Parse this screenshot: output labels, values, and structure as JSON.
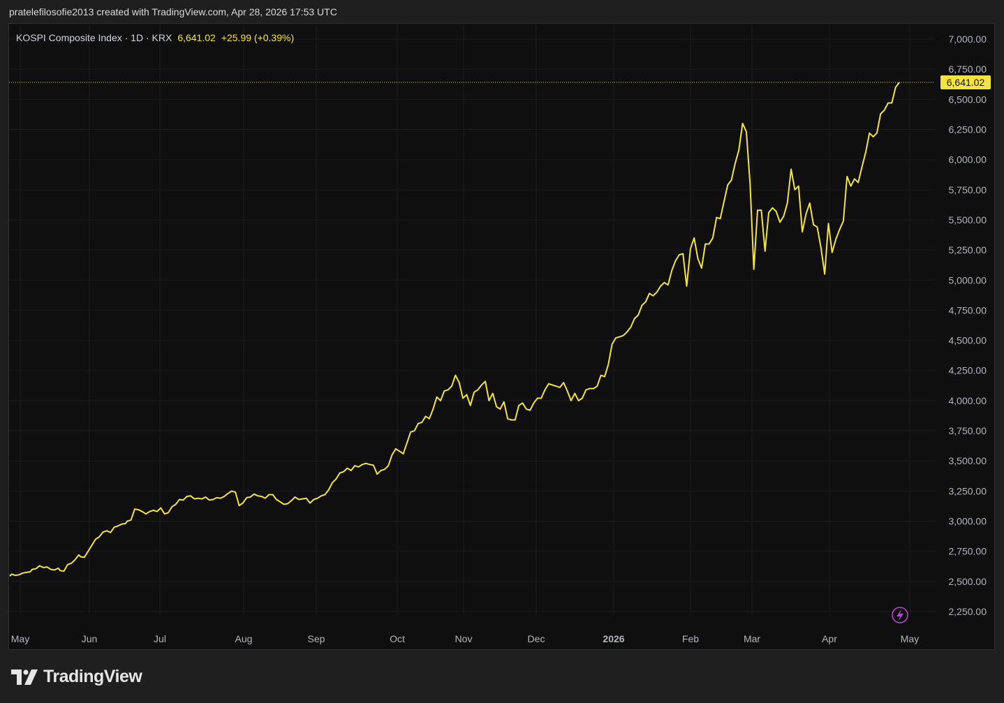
{
  "attribution": "pratelefilosofie2013 created with TradingView.com, Apr 28, 2026 17:53 UTC",
  "legend": {
    "symbol": "KOSPI Composite Index · 1D · KRX",
    "last": "6,641.02",
    "change": "+25.99 (+0.39%)"
  },
  "brand": {
    "name": "TradingView"
  },
  "colors": {
    "line": "#f5e342",
    "grid": "#1c1c1c",
    "axis_text": "#b2b5be",
    "background": "#0f0f0f"
  },
  "icons": {
    "brand_logo": "tradingview-logo-icon",
    "lightning": "lightning-icon"
  },
  "chart_data": {
    "type": "line",
    "series": [
      {
        "values": [
          [
            0,
            2545
          ],
          [
            1,
            2560
          ],
          [
            3,
            2550
          ],
          [
            5,
            2555
          ],
          [
            7,
            2570
          ],
          [
            9,
            2575
          ],
          [
            11,
            2580
          ],
          [
            12,
            2600
          ],
          [
            14,
            2605
          ],
          [
            16,
            2630
          ],
          [
            18,
            2615
          ],
          [
            20,
            2620
          ],
          [
            22,
            2600
          ],
          [
            24,
            2595
          ],
          [
            26,
            2610
          ],
          [
            27,
            2590
          ],
          [
            29,
            2585
          ],
          [
            31,
            2640
          ],
          [
            33,
            2650
          ],
          [
            35,
            2680
          ],
          [
            37,
            2720
          ],
          [
            38,
            2705
          ],
          [
            40,
            2700
          ],
          [
            42,
            2750
          ],
          [
            44,
            2800
          ],
          [
            46,
            2850
          ],
          [
            48,
            2870
          ],
          [
            50,
            2910
          ],
          [
            52,
            2920
          ],
          [
            54,
            2905
          ],
          [
            56,
            2950
          ],
          [
            58,
            2960
          ],
          [
            60,
            2975
          ],
          [
            62,
            2980
          ],
          [
            63,
            3000
          ],
          [
            65,
            3010
          ],
          [
            67,
            3100
          ],
          [
            69,
            3095
          ],
          [
            71,
            3080
          ],
          [
            73,
            3060
          ],
          [
            75,
            3080
          ],
          [
            77,
            3090
          ],
          [
            79,
            3080
          ],
          [
            81,
            3110
          ],
          [
            83,
            3060
          ],
          [
            85,
            3070
          ],
          [
            87,
            3120
          ],
          [
            89,
            3140
          ],
          [
            91,
            3180
          ],
          [
            93,
            3175
          ],
          [
            95,
            3205
          ],
          [
            97,
            3210
          ],
          [
            99,
            3185
          ],
          [
            101,
            3190
          ],
          [
            103,
            3185
          ],
          [
            105,
            3200
          ],
          [
            107,
            3175
          ],
          [
            109,
            3180
          ],
          [
            111,
            3195
          ],
          [
            113,
            3190
          ],
          [
            115,
            3205
          ],
          [
            117,
            3230
          ],
          [
            119,
            3250
          ],
          [
            121,
            3240
          ],
          [
            123,
            3130
          ],
          [
            125,
            3150
          ],
          [
            127,
            3195
          ],
          [
            129,
            3200
          ],
          [
            131,
            3225
          ],
          [
            133,
            3210
          ],
          [
            135,
            3205
          ],
          [
            137,
            3190
          ],
          [
            139,
            3220
          ],
          [
            141,
            3220
          ],
          [
            143,
            3180
          ],
          [
            145,
            3160
          ],
          [
            147,
            3140
          ],
          [
            149,
            3145
          ],
          [
            151,
            3170
          ],
          [
            153,
            3200
          ],
          [
            155,
            3180
          ],
          [
            157,
            3185
          ],
          [
            159,
            3190
          ],
          [
            161,
            3150
          ],
          [
            163,
            3180
          ],
          [
            165,
            3190
          ],
          [
            167,
            3210
          ],
          [
            169,
            3220
          ],
          [
            171,
            3260
          ],
          [
            173,
            3320
          ],
          [
            175,
            3350
          ],
          [
            177,
            3400
          ],
          [
            179,
            3410
          ],
          [
            181,
            3440
          ],
          [
            183,
            3420
          ],
          [
            185,
            3460
          ],
          [
            187,
            3450
          ],
          [
            189,
            3470
          ],
          [
            191,
            3480
          ],
          [
            193,
            3470
          ],
          [
            195,
            3465
          ],
          [
            197,
            3390
          ],
          [
            199,
            3420
          ],
          [
            201,
            3430
          ],
          [
            203,
            3460
          ],
          [
            205,
            3550
          ],
          [
            207,
            3600
          ],
          [
            209,
            3580
          ],
          [
            211,
            3560
          ],
          [
            213,
            3650
          ],
          [
            215,
            3740
          ],
          [
            217,
            3750
          ],
          [
            219,
            3810
          ],
          [
            221,
            3820
          ],
          [
            223,
            3870
          ],
          [
            225,
            3850
          ],
          [
            227,
            3930
          ],
          [
            229,
            4030
          ],
          [
            231,
            4000
          ],
          [
            233,
            4080
          ],
          [
            235,
            4090
          ],
          [
            237,
            4120
          ],
          [
            239,
            4210
          ],
          [
            241,
            4150
          ],
          [
            243,
            4020
          ],
          [
            245,
            4050
          ],
          [
            247,
            3960
          ],
          [
            249,
            4070
          ],
          [
            251,
            4090
          ],
          [
            253,
            4130
          ],
          [
            255,
            4160
          ],
          [
            257,
            4000
          ],
          [
            259,
            4060
          ],
          [
            261,
            3950
          ],
          [
            263,
            3930
          ],
          [
            265,
            3990
          ],
          [
            267,
            3850
          ],
          [
            269,
            3840
          ],
          [
            271,
            3840
          ],
          [
            273,
            3960
          ],
          [
            275,
            3980
          ],
          [
            277,
            3930
          ],
          [
            279,
            3920
          ],
          [
            281,
            3980
          ],
          [
            283,
            4020
          ],
          [
            285,
            4020
          ],
          [
            287,
            4090
          ],
          [
            289,
            4140
          ],
          [
            291,
            4130
          ],
          [
            293,
            4120
          ],
          [
            295,
            4110
          ],
          [
            297,
            4150
          ],
          [
            299,
            4080
          ],
          [
            301,
            4000
          ],
          [
            303,
            4060
          ],
          [
            305,
            4000
          ],
          [
            307,
            4020
          ],
          [
            309,
            4090
          ],
          [
            311,
            4100
          ],
          [
            313,
            4100
          ],
          [
            315,
            4120
          ],
          [
            317,
            4210
          ],
          [
            319,
            4200
          ],
          [
            321,
            4300
          ],
          [
            323,
            4470
          ],
          [
            325,
            4520
          ],
          [
            327,
            4530
          ],
          [
            329,
            4540
          ],
          [
            331,
            4570
          ],
          [
            333,
            4610
          ],
          [
            335,
            4680
          ],
          [
            337,
            4710
          ],
          [
            339,
            4790
          ],
          [
            341,
            4820
          ],
          [
            343,
            4890
          ],
          [
            345,
            4870
          ],
          [
            347,
            4900
          ],
          [
            349,
            4950
          ],
          [
            351,
            4980
          ],
          [
            353,
            4960
          ],
          [
            355,
            5080
          ],
          [
            357,
            5160
          ],
          [
            359,
            5210
          ],
          [
            361,
            5220
          ],
          [
            363,
            4950
          ],
          [
            365,
            5260
          ],
          [
            367,
            5350
          ],
          [
            369,
            5180
          ],
          [
            371,
            5100
          ],
          [
            373,
            5300
          ],
          [
            375,
            5300
          ],
          [
            377,
            5350
          ],
          [
            379,
            5520
          ],
          [
            381,
            5510
          ],
          [
            383,
            5650
          ],
          [
            385,
            5790
          ],
          [
            387,
            5830
          ],
          [
            389,
            5970
          ],
          [
            391,
            6080
          ],
          [
            393,
            6300
          ],
          [
            395,
            6230
          ],
          [
            397,
            5800
          ],
          [
            399,
            5090
          ],
          [
            401,
            5580
          ],
          [
            403,
            5580
          ],
          [
            405,
            5240
          ],
          [
            407,
            5560
          ],
          [
            409,
            5600
          ],
          [
            411,
            5570
          ],
          [
            413,
            5480
          ],
          [
            415,
            5530
          ],
          [
            417,
            5640
          ],
          [
            419,
            5920
          ],
          [
            421,
            5750
          ],
          [
            423,
            5780
          ],
          [
            425,
            5400
          ],
          [
            427,
            5550
          ],
          [
            429,
            5640
          ],
          [
            431,
            5460
          ],
          [
            433,
            5440
          ],
          [
            435,
            5270
          ],
          [
            437,
            5050
          ],
          [
            439,
            5470
          ],
          [
            441,
            5230
          ],
          [
            443,
            5340
          ],
          [
            445,
            5420
          ],
          [
            447,
            5490
          ],
          [
            449,
            5860
          ],
          [
            451,
            5780
          ],
          [
            453,
            5840
          ],
          [
            455,
            5810
          ],
          [
            457,
            5940
          ],
          [
            459,
            6060
          ],
          [
            461,
            6220
          ],
          [
            463,
            6190
          ],
          [
            465,
            6220
          ],
          [
            467,
            6380
          ],
          [
            469,
            6410
          ],
          [
            471,
            6470
          ],
          [
            473,
            6470
          ],
          [
            475,
            6600
          ],
          [
            477,
            6641.02
          ]
        ]
      }
    ],
    "y_ticks": [
      "7,000.00",
      "6,750.00",
      "6,500.00",
      "6,250.00",
      "6,000.00",
      "5,750.00",
      "5,500.00",
      "5,250.00",
      "5,000.00",
      "4,750.00",
      "4,500.00",
      "4,250.00",
      "4,000.00",
      "3,750.00",
      "3,500.00",
      "3,250.00",
      "3,000.00",
      "2,750.00",
      "2,500.00",
      "2,250.00"
    ],
    "y_tick_values": [
      7000,
      6750,
      6500,
      6250,
      6000,
      5750,
      5500,
      5250,
      5000,
      4750,
      4500,
      4250,
      4000,
      3750,
      3500,
      3250,
      3000,
      2750,
      2500,
      2250
    ],
    "x_ticks": [
      "May",
      "Jun",
      "Jul",
      "Aug",
      "Sep",
      "Oct",
      "Nov",
      "Dec",
      "2026",
      "Feb",
      "Mar",
      "Apr",
      "May"
    ],
    "x_tick_bold": [
      false,
      false,
      false,
      false,
      false,
      false,
      false,
      false,
      true,
      false,
      false,
      false,
      false
    ],
    "x_range": [
      0,
      477
    ],
    "ylim": [
      2100,
      7200
    ],
    "last_price": 6641.02,
    "last_price_label": "6,641.02",
    "grid": true
  }
}
